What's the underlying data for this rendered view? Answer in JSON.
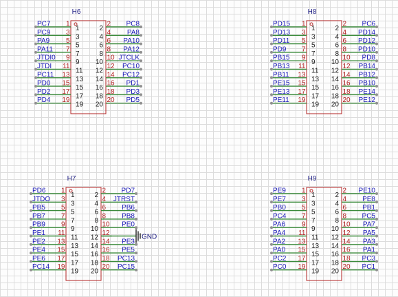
{
  "ground_label": "GND",
  "colors": {
    "body": "#b22222",
    "wire": "#3a8a3a",
    "net": "#1a1ab8",
    "pin_number": "#b22222",
    "pin_inside": "#222222",
    "designator": "#1a1a80",
    "dot": "#909090"
  },
  "headers": [
    {
      "designator": "H6",
      "odd_nets": [
        "PC7",
        "PC9",
        "PA9",
        "PA11",
        "JTDI0",
        "JTDI",
        "PC11",
        "PD0",
        "PD2",
        "PD4"
      ],
      "even_nets": [
        "PC8",
        "PA8",
        "PA10",
        "PA12",
        "JTCLK",
        "PC10",
        "PC12",
        "PD1",
        "PD3",
        "PD5"
      ]
    },
    {
      "designator": "H8",
      "odd_nets": [
        "PD15",
        "PD13",
        "PD11",
        "PD9",
        "PB15",
        "PB13",
        "PB11",
        "PE15",
        "PE13",
        "PE11"
      ],
      "even_nets": [
        "PC6",
        "PD14",
        "PD12",
        "PD10",
        "PD8",
        "PB14",
        "PB12",
        "PB10",
        "PE14",
        "PE12"
      ]
    },
    {
      "designator": "H7",
      "odd_nets": [
        "PD6",
        "JTDO",
        "PB5",
        "PB7",
        "PB9",
        "PE1",
        "PE2",
        "PE4",
        "PE6",
        "PC14"
      ],
      "even_nets": [
        "PD7",
        "JTRST",
        "PB6",
        "PB8",
        "PE0",
        "",
        "PE3",
        "PE5",
        "PC13",
        "PC15"
      ]
    },
    {
      "designator": "H9",
      "odd_nets": [
        "PE9",
        "PE7",
        "PB0",
        "PC4",
        "PA6",
        "PA4",
        "PA2",
        "PA0",
        "PC2",
        "PC0"
      ],
      "even_nets": [
        "PE10",
        "PE8",
        "PB1",
        "PC5",
        "PA7",
        "PA5",
        "PA3",
        "PA1",
        "PC3",
        "PC1"
      ]
    }
  ]
}
